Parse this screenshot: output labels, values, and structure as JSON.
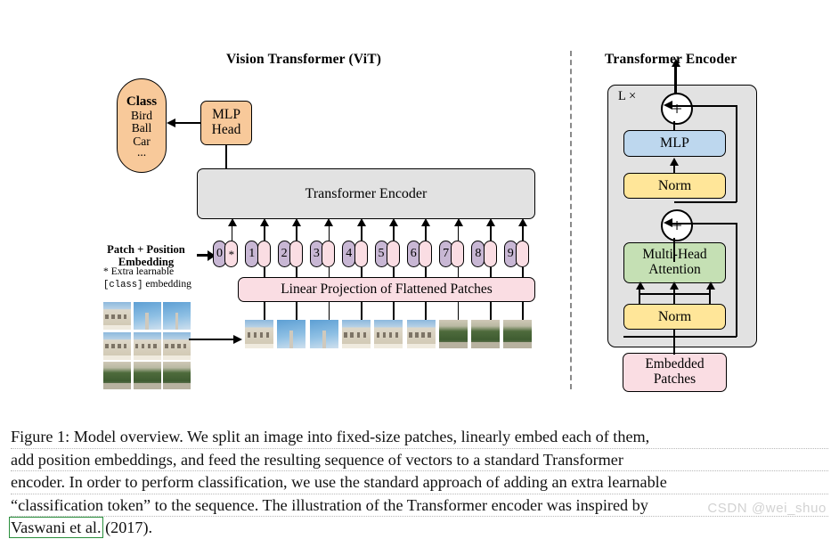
{
  "figure": {
    "left_panel_title": "Vision Transformer (ViT)",
    "right_panel_title": "Transformer Encoder"
  },
  "left_panel": {
    "class_box": {
      "heading": "Class",
      "items": [
        "Bird",
        "Ball",
        "Car",
        "..."
      ],
      "color": "#f8c99a"
    },
    "mlp_head": {
      "line1": "MLP",
      "line2": "Head",
      "color": "#f8c99a"
    },
    "encoder_box": {
      "label": "Transformer Encoder",
      "color": "#e2e2e2"
    },
    "linear_projection": {
      "label": "Linear Projection of Flattened Patches",
      "color": "#fadde3"
    },
    "embedding_label": {
      "line1": "Patch + Position",
      "line2": "Embedding"
    },
    "footnote": {
      "line1": "* Extra learnable",
      "mono": "[class]",
      "line2_tail": " embedding"
    },
    "tokens": [
      {
        "num": "0",
        "pos": "*"
      },
      {
        "num": "1",
        "pos": ""
      },
      {
        "num": "2",
        "pos": ""
      },
      {
        "num": "3",
        "pos": ""
      },
      {
        "num": "4",
        "pos": ""
      },
      {
        "num": "5",
        "pos": ""
      },
      {
        "num": "6",
        "pos": ""
      },
      {
        "num": "7",
        "pos": ""
      },
      {
        "num": "8",
        "pos": ""
      },
      {
        "num": "9",
        "pos": ""
      }
    ],
    "token_colors": {
      "number_pill": "#c8b7d4",
      "position_pill": "#fadde3"
    },
    "source_image_grid": {
      "rows": 3,
      "cols": 3,
      "caption": "source image split into patches"
    },
    "patch_strip_count": 9
  },
  "right_panel": {
    "repeat_label": "L ×",
    "blocks": [
      {
        "id": "mlp",
        "label": "MLP",
        "color": "#bdd7ee"
      },
      {
        "id": "norm_top",
        "label": "Norm",
        "color": "#ffe699"
      },
      {
        "id": "attention",
        "line1": "Multi-Head",
        "line2": "Attention",
        "color": "#c5e0b4"
      },
      {
        "id": "norm_bottom",
        "label": "Norm",
        "color": "#ffe699"
      }
    ],
    "embedded_patches": {
      "line1": "Embedded",
      "line2": "Patches",
      "color": "#fadde3"
    },
    "residual_adders": [
      "+",
      "+"
    ],
    "container_color": "#e2e2e2"
  },
  "caption": {
    "lines": [
      "Figure 1: Model overview. We split an image into fixed-size patches, linearly embed each of them,",
      "add position embeddings, and feed the resulting sequence of vectors to a standard Transformer",
      "encoder. In order to perform classification, we use the standard approach of adding an extra learnable",
      "“classification token” to the sequence. The illustration of the Transformer encoder was inspired by"
    ],
    "last_line_boxed": "Vaswani et al.",
    "last_line_rest": " (2017)."
  },
  "watermark": "CSDN @wei_shuo"
}
